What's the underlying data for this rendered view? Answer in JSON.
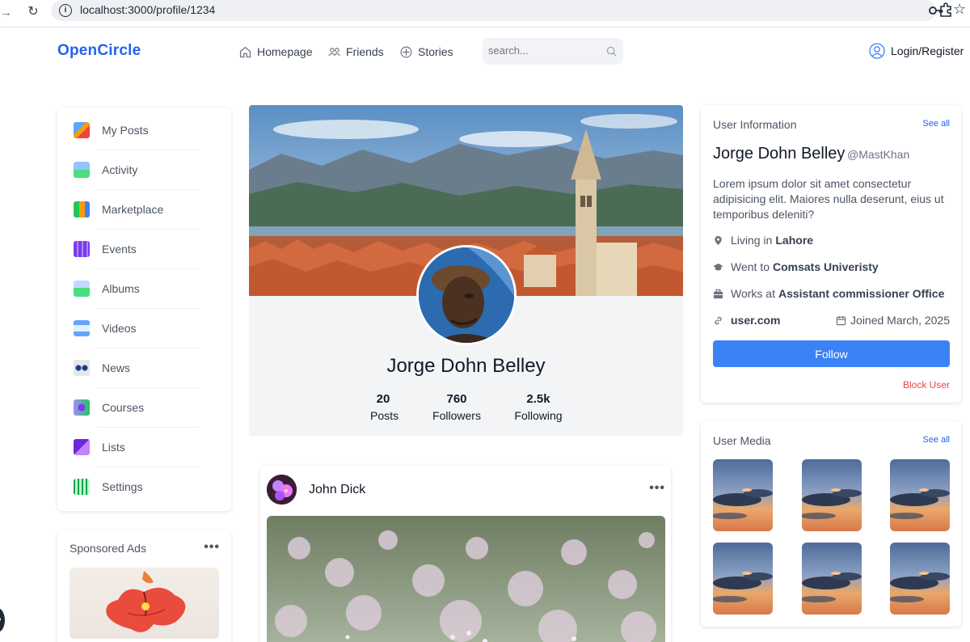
{
  "browser": {
    "url": "localhost:3000/profile/1234"
  },
  "header": {
    "logo": "OpenCircle",
    "nav": [
      {
        "label": "Homepage",
        "icon": "home-icon"
      },
      {
        "label": "Friends",
        "icon": "friends-icon"
      },
      {
        "label": "Stories",
        "icon": "stories-icon"
      }
    ],
    "search_placeholder": "search...",
    "login_label": "Login/Register"
  },
  "sidebar": {
    "items": [
      {
        "label": "My Posts",
        "icon": "my-posts-icon"
      },
      {
        "label": "Activity",
        "icon": "activity-icon"
      },
      {
        "label": "Marketplace",
        "icon": "marketplace-icon"
      },
      {
        "label": "Events",
        "icon": "events-icon"
      },
      {
        "label": "Albums",
        "icon": "albums-icon"
      },
      {
        "label": "Videos",
        "icon": "videos-icon"
      },
      {
        "label": "News",
        "icon": "news-icon"
      },
      {
        "label": "Courses",
        "icon": "courses-icon"
      },
      {
        "label": "Lists",
        "icon": "lists-icon"
      },
      {
        "label": "Settings",
        "icon": "settings-icon"
      }
    ]
  },
  "ads": {
    "title": "Sponsored Ads",
    "more": "•••"
  },
  "profile": {
    "name": "Jorge Dohn Belley",
    "stats": [
      {
        "value": "20",
        "label": "Posts"
      },
      {
        "value": "760",
        "label": "Followers"
      },
      {
        "value": "2.5k",
        "label": "Following"
      }
    ]
  },
  "post": {
    "author": "John Dick",
    "more": "•••"
  },
  "user_info": {
    "title": "User Information",
    "see_all": "See all",
    "name": "Jorge Dohn Belley",
    "handle": "@MastKhan",
    "bio": "Lorem ipsum dolor sit amet consectetur adipisicing elit. Maiores nulla deserunt, eius ut temporibus deleniti?",
    "living_prefix": "Living in",
    "living": "Lahore",
    "went_prefix": "Went to",
    "went": "Comsats Univeristy",
    "works_prefix": "Works at",
    "works": "Assistant commissioner Office",
    "link": "user.com",
    "joined": "Joined March, 2025",
    "follow_label": "Follow",
    "block_label": "Block User"
  },
  "user_media": {
    "title": "User Media",
    "see_all": "See all",
    "count": 6
  },
  "colors": {
    "accent": "#3b82f6",
    "brand": "#2563eb",
    "danger": "#ef4444"
  }
}
